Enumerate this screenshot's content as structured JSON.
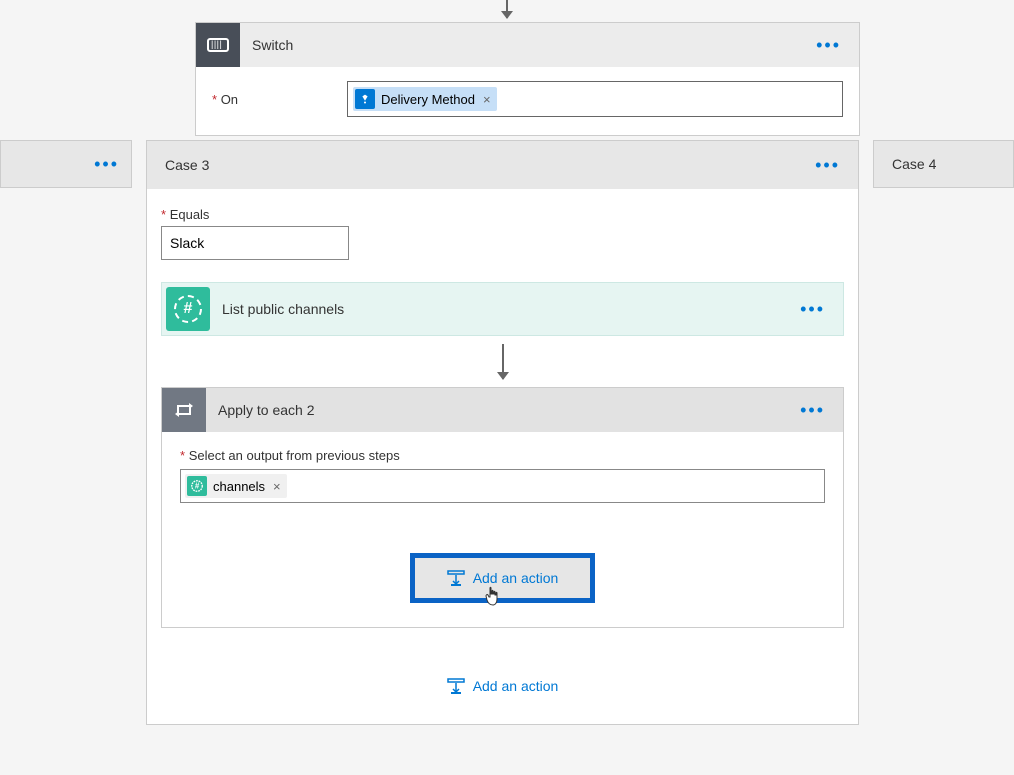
{
  "switch": {
    "title": "Switch",
    "on_label": "On",
    "token_label": "Delivery Method"
  },
  "case3": {
    "title": "Case 3",
    "equals_label": "Equals",
    "equals_value": "Slack",
    "slack_action": "List public channels",
    "apply": {
      "title": "Apply to each 2",
      "select_label": "Select an output from previous steps",
      "token_label": "channels",
      "add_action_inner": "Add an action"
    },
    "add_action_outer": "Add an action"
  },
  "case4": {
    "title": "Case 4"
  }
}
